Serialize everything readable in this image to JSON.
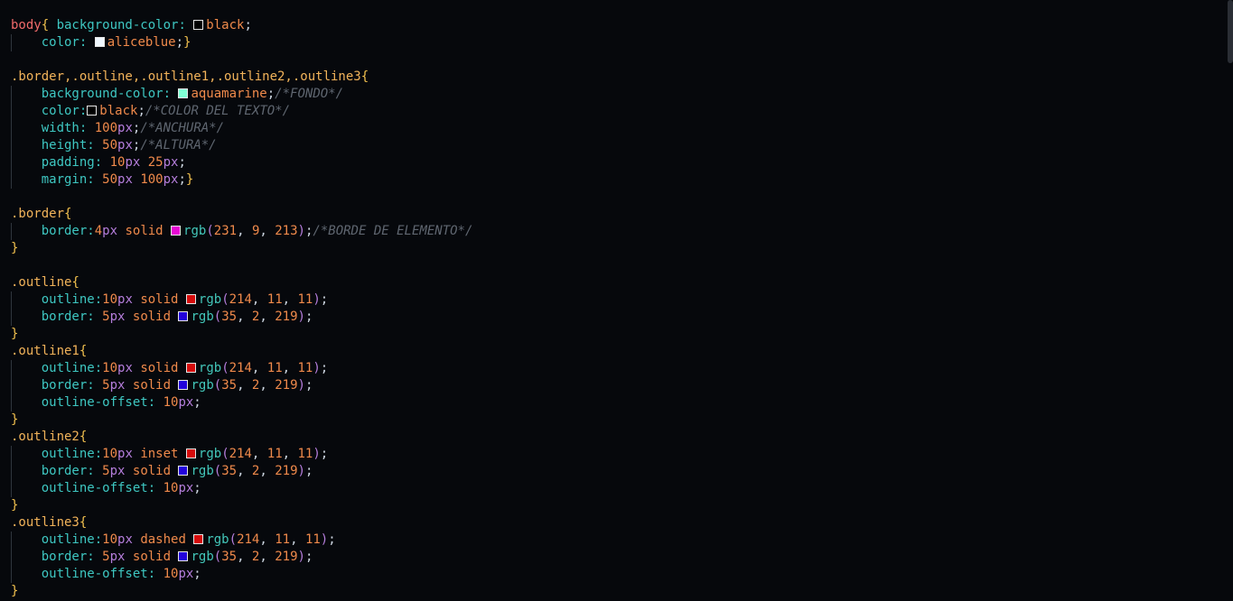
{
  "code_lines": [
    [
      [
        "tag",
        "body"
      ],
      [
        "brace",
        "{ "
      ],
      [
        "prop",
        "background-color: "
      ],
      [
        "swatch",
        "#000000"
      ],
      [
        "kw",
        "black"
      ],
      [
        "punct",
        ";"
      ]
    ],
    [
      [
        "punct",
        "    "
      ],
      [
        "prop",
        "color: "
      ],
      [
        "swatch",
        "#f0f8ff"
      ],
      [
        "kw",
        "aliceblue"
      ],
      [
        "punct",
        ";"
      ],
      [
        "brace",
        "}"
      ]
    ],
    [],
    [
      [
        "sel",
        ".border,.outline,.outline1,.outline2,.outline3"
      ],
      [
        "brace",
        "{"
      ]
    ],
    [
      [
        "punct",
        "    "
      ],
      [
        "prop",
        "background-color: "
      ],
      [
        "swatch",
        "#7fffd4"
      ],
      [
        "kw",
        "aquamarine"
      ],
      [
        "punct",
        ";"
      ],
      [
        "comment",
        "/*FONDO*/"
      ]
    ],
    [
      [
        "punct",
        "    "
      ],
      [
        "prop",
        "color:"
      ],
      [
        "swatch",
        "#000000"
      ],
      [
        "kw",
        "black"
      ],
      [
        "punct",
        ";"
      ],
      [
        "comment",
        "/*COLOR DEL TEXTO*/"
      ]
    ],
    [
      [
        "punct",
        "    "
      ],
      [
        "prop",
        "width: "
      ],
      [
        "num",
        "100"
      ],
      [
        "unit",
        "px"
      ],
      [
        "punct",
        ";"
      ],
      [
        "comment",
        "/*ANCHURA*/"
      ]
    ],
    [
      [
        "punct",
        "    "
      ],
      [
        "prop",
        "height: "
      ],
      [
        "num",
        "50"
      ],
      [
        "unit",
        "px"
      ],
      [
        "punct",
        ";"
      ],
      [
        "comment",
        "/*ALTURA*/"
      ]
    ],
    [
      [
        "punct",
        "    "
      ],
      [
        "prop",
        "padding: "
      ],
      [
        "num",
        "10"
      ],
      [
        "unit",
        "px "
      ],
      [
        "num",
        "25"
      ],
      [
        "unit",
        "px"
      ],
      [
        "punct",
        ";"
      ]
    ],
    [
      [
        "punct",
        "    "
      ],
      [
        "prop",
        "margin: "
      ],
      [
        "num",
        "50"
      ],
      [
        "unit",
        "px "
      ],
      [
        "num",
        "100"
      ],
      [
        "unit",
        "px"
      ],
      [
        "punct",
        ";"
      ],
      [
        "brace",
        "}"
      ]
    ],
    [],
    [
      [
        "sel",
        ".border"
      ],
      [
        "brace",
        "{"
      ]
    ],
    [
      [
        "punct",
        "    "
      ],
      [
        "prop",
        "border:"
      ],
      [
        "num",
        "4"
      ],
      [
        "unit",
        "px "
      ],
      [
        "kw",
        "solid "
      ],
      [
        "swatch",
        "#e709d5"
      ],
      [
        "fn",
        "rgb"
      ],
      [
        "paren",
        "("
      ],
      [
        "num",
        "231"
      ],
      [
        "punct",
        ", "
      ],
      [
        "num",
        "9"
      ],
      [
        "punct",
        ", "
      ],
      [
        "num",
        "213"
      ],
      [
        "paren",
        ")"
      ],
      [
        "punct",
        ";"
      ],
      [
        "comment",
        "/*BORDE DE ELEMENTO*/"
      ]
    ],
    [
      [
        "brace",
        "}"
      ]
    ],
    [],
    [
      [
        "sel",
        ".outline"
      ],
      [
        "brace",
        "{"
      ]
    ],
    [
      [
        "punct",
        "    "
      ],
      [
        "prop",
        "outline:"
      ],
      [
        "num",
        "10"
      ],
      [
        "unit",
        "px "
      ],
      [
        "kw",
        "solid "
      ],
      [
        "swatch",
        "#d60b0b"
      ],
      [
        "fn",
        "rgb"
      ],
      [
        "paren",
        "("
      ],
      [
        "num",
        "214"
      ],
      [
        "punct",
        ", "
      ],
      [
        "num",
        "11"
      ],
      [
        "punct",
        ", "
      ],
      [
        "num",
        "11"
      ],
      [
        "paren",
        ")"
      ],
      [
        "punct",
        ";"
      ]
    ],
    [
      [
        "punct",
        "    "
      ],
      [
        "prop",
        "border: "
      ],
      [
        "num",
        "5"
      ],
      [
        "unit",
        "px "
      ],
      [
        "kw",
        "solid "
      ],
      [
        "swatch",
        "#2302db"
      ],
      [
        "fn",
        "rgb"
      ],
      [
        "paren",
        "("
      ],
      [
        "num",
        "35"
      ],
      [
        "punct",
        ", "
      ],
      [
        "num",
        "2"
      ],
      [
        "punct",
        ", "
      ],
      [
        "num",
        "219"
      ],
      [
        "paren",
        ")"
      ],
      [
        "punct",
        ";"
      ]
    ],
    [
      [
        "brace",
        "}"
      ]
    ],
    [
      [
        "sel",
        ".outline1"
      ],
      [
        "brace",
        "{"
      ]
    ],
    [
      [
        "punct",
        "    "
      ],
      [
        "prop",
        "outline:"
      ],
      [
        "num",
        "10"
      ],
      [
        "unit",
        "px "
      ],
      [
        "kw",
        "solid "
      ],
      [
        "swatch",
        "#d60b0b"
      ],
      [
        "fn",
        "rgb"
      ],
      [
        "paren",
        "("
      ],
      [
        "num",
        "214"
      ],
      [
        "punct",
        ", "
      ],
      [
        "num",
        "11"
      ],
      [
        "punct",
        ", "
      ],
      [
        "num",
        "11"
      ],
      [
        "paren",
        ")"
      ],
      [
        "punct",
        ";"
      ]
    ],
    [
      [
        "punct",
        "    "
      ],
      [
        "prop",
        "border: "
      ],
      [
        "num",
        "5"
      ],
      [
        "unit",
        "px "
      ],
      [
        "kw",
        "solid "
      ],
      [
        "swatch",
        "#2302db"
      ],
      [
        "fn",
        "rgb"
      ],
      [
        "paren",
        "("
      ],
      [
        "num",
        "35"
      ],
      [
        "punct",
        ", "
      ],
      [
        "num",
        "2"
      ],
      [
        "punct",
        ", "
      ],
      [
        "num",
        "219"
      ],
      [
        "paren",
        ")"
      ],
      [
        "punct",
        ";"
      ]
    ],
    [
      [
        "punct",
        "    "
      ],
      [
        "prop",
        "outline-offset: "
      ],
      [
        "num",
        "10"
      ],
      [
        "unit",
        "px"
      ],
      [
        "punct",
        ";"
      ]
    ],
    [
      [
        "brace",
        "}"
      ]
    ],
    [
      [
        "sel",
        ".outline2"
      ],
      [
        "brace",
        "{"
      ]
    ],
    [
      [
        "punct",
        "    "
      ],
      [
        "prop",
        "outline:"
      ],
      [
        "num",
        "10"
      ],
      [
        "unit",
        "px "
      ],
      [
        "kw",
        "inset "
      ],
      [
        "swatch",
        "#d60b0b"
      ],
      [
        "fn",
        "rgb"
      ],
      [
        "paren",
        "("
      ],
      [
        "num",
        "214"
      ],
      [
        "punct",
        ", "
      ],
      [
        "num",
        "11"
      ],
      [
        "punct",
        ", "
      ],
      [
        "num",
        "11"
      ],
      [
        "paren",
        ")"
      ],
      [
        "punct",
        ";"
      ]
    ],
    [
      [
        "punct",
        "    "
      ],
      [
        "prop",
        "border: "
      ],
      [
        "num",
        "5"
      ],
      [
        "unit",
        "px "
      ],
      [
        "kw",
        "solid "
      ],
      [
        "swatch",
        "#2302db"
      ],
      [
        "fn",
        "rgb"
      ],
      [
        "paren",
        "("
      ],
      [
        "num",
        "35"
      ],
      [
        "punct",
        ", "
      ],
      [
        "num",
        "2"
      ],
      [
        "punct",
        ", "
      ],
      [
        "num",
        "219"
      ],
      [
        "paren",
        ")"
      ],
      [
        "punct",
        ";"
      ]
    ],
    [
      [
        "punct",
        "    "
      ],
      [
        "prop",
        "outline-offset: "
      ],
      [
        "num",
        "10"
      ],
      [
        "unit",
        "px"
      ],
      [
        "punct",
        ";"
      ]
    ],
    [
      [
        "brace",
        "}"
      ]
    ],
    [
      [
        "sel",
        ".outline3"
      ],
      [
        "brace",
        "{"
      ]
    ],
    [
      [
        "punct",
        "    "
      ],
      [
        "prop",
        "outline:"
      ],
      [
        "num",
        "10"
      ],
      [
        "unit",
        "px "
      ],
      [
        "kw",
        "dashed "
      ],
      [
        "swatch",
        "#d60b0b"
      ],
      [
        "fn",
        "rgb"
      ],
      [
        "paren",
        "("
      ],
      [
        "num",
        "214"
      ],
      [
        "punct",
        ", "
      ],
      [
        "num",
        "11"
      ],
      [
        "punct",
        ", "
      ],
      [
        "num",
        "11"
      ],
      [
        "paren",
        ")"
      ],
      [
        "punct",
        ";"
      ]
    ],
    [
      [
        "punct",
        "    "
      ],
      [
        "prop",
        "border: "
      ],
      [
        "num",
        "5"
      ],
      [
        "unit",
        "px "
      ],
      [
        "kw",
        "solid "
      ],
      [
        "swatch",
        "#2302db"
      ],
      [
        "fn",
        "rgb"
      ],
      [
        "paren",
        "("
      ],
      [
        "num",
        "35"
      ],
      [
        "punct",
        ", "
      ],
      [
        "num",
        "2"
      ],
      [
        "punct",
        ", "
      ],
      [
        "num",
        "219"
      ],
      [
        "paren",
        ")"
      ],
      [
        "punct",
        ";"
      ]
    ],
    [
      [
        "punct",
        "    "
      ],
      [
        "prop",
        "outline-offset: "
      ],
      [
        "num",
        "10"
      ],
      [
        "unit",
        "px"
      ],
      [
        "punct",
        ";"
      ]
    ],
    [
      [
        "brace",
        "}"
      ]
    ]
  ]
}
